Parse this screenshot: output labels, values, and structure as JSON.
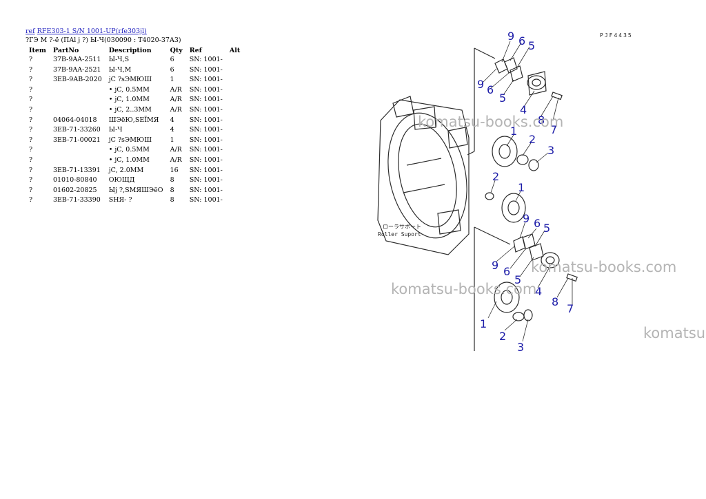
{
  "header": {
    "ref_link": "ref",
    "model_link": "RFE303-1 S/N 1001-UP(rfe303jl)",
    "subtitle": "?ГЭ М ?-ё (ПAl j ?) Ы-Ч(030090 : T4020-37A3)"
  },
  "table": {
    "columns": [
      "Item",
      "PartNo",
      "Description",
      "Qty",
      "Ref",
      "Alt"
    ],
    "rows": [
      [
        "?",
        "37B-9AA-2511",
        "Ы-Ч,S",
        "6",
        "SN: 1001-",
        ""
      ],
      [
        "?",
        "37B-9AA-2521",
        "Ы-Ч,M",
        "6",
        "SN: 1001-",
        ""
      ],
      [
        "?",
        "3EB-9AB-2020",
        "jC ?sЭМЮШ",
        "1",
        "SN: 1001-",
        ""
      ],
      [
        "?",
        "",
        "• jC, 0.5MM",
        "A/R",
        "SN: 1001-",
        ""
      ],
      [
        "?",
        "",
        "• jC, 1.0MM",
        "A/R",
        "SN: 1001-",
        ""
      ],
      [
        "?",
        "",
        "• jC, 2..3MM",
        "A/R",
        "SN: 1001-",
        ""
      ],
      [
        "?",
        "04064-04018",
        "ШЭёЮ,SЕЇМЯ",
        "4",
        "SN: 1001-",
        ""
      ],
      [
        "?",
        "3EB-71-33260",
        "Ы-Ч",
        "4",
        "SN: 1001-",
        ""
      ],
      [
        "?",
        "3EB-71-00021",
        "jC ?sЭМЮШ",
        "1",
        "SN: 1001-",
        ""
      ],
      [
        "?",
        "",
        "• jC, 0.5MM",
        "A/R",
        "SN: 1001-",
        ""
      ],
      [
        "?",
        "",
        "• jC, 1.0MM",
        "A/R",
        "SN: 1001-",
        ""
      ],
      [
        "?",
        "3EB-71-13391",
        "jC, 2.0MM",
        "16",
        "SN: 1001-",
        ""
      ],
      [
        "?",
        "01010-80840",
        "ОЮЩД",
        "8",
        "SN: 1001-",
        ""
      ],
      [
        "?",
        "01602-20825",
        "Ыj ?,SМЯШЭёО",
        "8",
        "SN: 1001-",
        ""
      ],
      [
        "?",
        "3EB-71-33390",
        "SНЯ- ?",
        "8",
        "SN: 1001-",
        ""
      ]
    ]
  },
  "diagram": {
    "code": "PJF4435",
    "jp_label": "ローラサポート",
    "en_label": "Roller Suport",
    "callout_color": "#1c1ca8",
    "callouts": [
      "9",
      "6",
      "5",
      "9",
      "6",
      "5",
      "4",
      "8",
      "7",
      "1",
      "2",
      "3",
      "2",
      "1",
      "9",
      "6",
      "5",
      "9",
      "6",
      "5",
      "4",
      "8",
      "7",
      "1",
      "2",
      "3"
    ]
  },
  "watermarks": [
    "komatsu-books.com",
    "komatsu-books.com",
    "komatsu-books.com",
    "komatsu"
  ]
}
